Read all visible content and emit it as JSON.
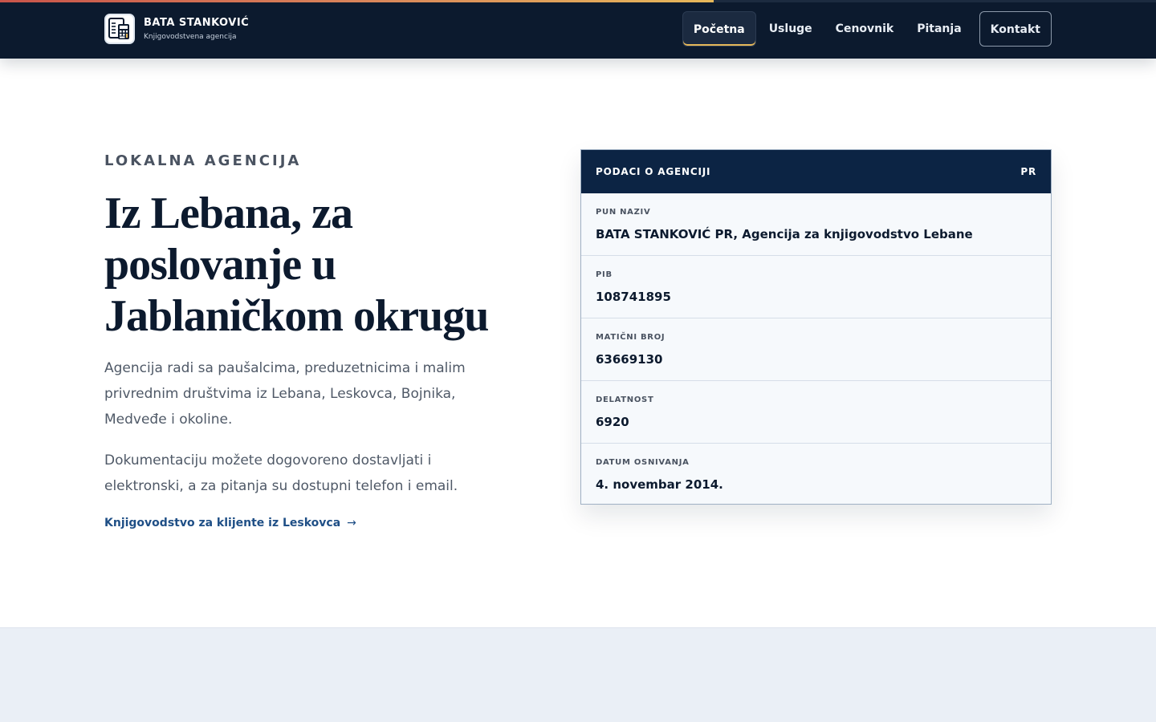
{
  "header": {
    "brand_name": "BATA STANKOVIĆ",
    "brand_tagline": "Knjigovodstvena agencija",
    "logo_icon": "calculator-document-icon",
    "nav": [
      {
        "label": "Početna",
        "active": true
      },
      {
        "label": "Usluge",
        "active": false
      },
      {
        "label": "Cenovnik",
        "active": false
      },
      {
        "label": "Pitanja",
        "active": false
      },
      {
        "label": "Kontakt",
        "active": false
      }
    ]
  },
  "hero": {
    "eyebrow": "LOKALNA AGENCIJA",
    "title": "Iz Lebana, za poslovanje u Jablaničkom okrugu",
    "paragraph1": "Agencija radi sa paušalcima, preduzetnicima i malim privrednim društvima iz Lebana, Leskovca, Bojnika, Medveđe i okoline.",
    "paragraph2": "Dokumentaciju možete dogovoreno dostavljati i elektronski, a za pitanja su dostupni telefon i email.",
    "link_label": "Knjigovodstvo za klijente iz Leskovca",
    "link_arrow": "→"
  },
  "card": {
    "title": "PODACI O AGENCIJI",
    "badge": "PR",
    "rows": [
      {
        "label": "PUN NAZIV",
        "value": "BATA STANKOVIĆ PR, Agencija za knjigovodstvo Lebane"
      },
      {
        "label": "PIB",
        "value": "108741895"
      },
      {
        "label": "MATIČNI BROJ",
        "value": "63669130"
      },
      {
        "label": "DELATNOST",
        "value": "6920"
      },
      {
        "label": "DATUM OSNIVANJA",
        "value": "4. novembar 2014."
      }
    ]
  },
  "colors": {
    "navy": "#0c1a2e",
    "card_header": "#0c2444",
    "accent_gold": "#e6b85a",
    "accent_red": "#c9544a",
    "link_blue": "#1f4f86"
  }
}
